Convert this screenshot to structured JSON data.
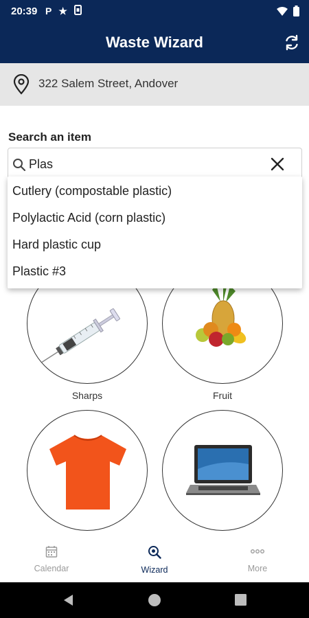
{
  "status_bar": {
    "time": "20:39",
    "icons": [
      "parking-icon",
      "star-icon",
      "sim-icon"
    ],
    "right_icons": [
      "wifi-icon",
      "battery-icon"
    ]
  },
  "app_bar": {
    "title": "Waste Wizard",
    "refresh_icon": "refresh-icon"
  },
  "address_bar": {
    "text": "322 Salem Street, Andover",
    "icon": "location-pin-icon"
  },
  "search": {
    "label": "Search an item",
    "value": "Plas",
    "suggestions": [
      "Cutlery (compostable plastic)",
      "Polylactic Acid (corn plastic)",
      "Hard plastic cup",
      "Plastic #3"
    ]
  },
  "categories": [
    {
      "label": "Sharps",
      "icon": "syringe-image"
    },
    {
      "label": "Fruit",
      "icon": "fruit-image"
    },
    {
      "label": "",
      "icon": "tshirt-image"
    },
    {
      "label": "",
      "icon": "laptop-image"
    }
  ],
  "bottom_nav": {
    "items": [
      {
        "label": "Calendar",
        "icon": "calendar-icon",
        "active": false
      },
      {
        "label": "Wizard",
        "icon": "wizard-search-icon",
        "active": true
      },
      {
        "label": "More",
        "icon": "more-icon",
        "active": false
      }
    ]
  },
  "colors": {
    "primary": "#0b2858",
    "address_bg": "#e6e6e6",
    "inactive_nav": "#9a9a9a"
  }
}
